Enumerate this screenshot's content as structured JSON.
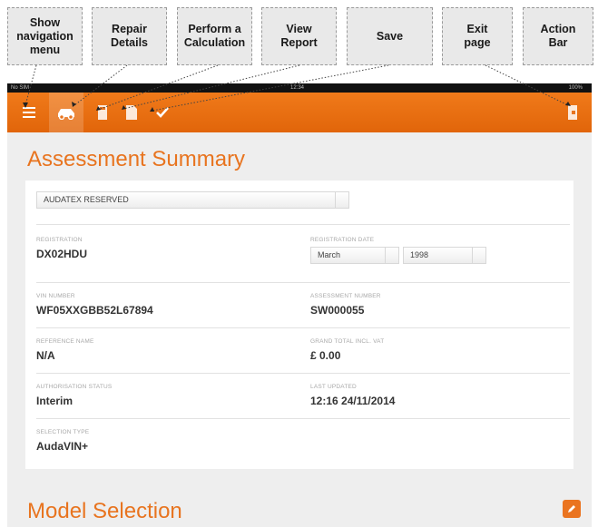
{
  "callouts": {
    "nav_menu": "Show\nnavigation\nmenu",
    "repair_details": "Repair\nDetails",
    "calculation": "Perform a\nCalculation",
    "view_report": "View\nReport",
    "save": "Save",
    "exit_page": "Exit\npage",
    "action_bar": "Action\nBar"
  },
  "status_bar": {
    "carrier": "No SIM",
    "time": "12:34",
    "battery": "100%"
  },
  "toolbar": {
    "icons": [
      "menu-icon",
      "car-icon",
      "calculator-icon",
      "report-icon",
      "checkmark-icon",
      "exit-icon"
    ],
    "color": "#e8741f"
  },
  "summary": {
    "title": "Assessment Summary",
    "dropdown": "AUDATEX RESERVED",
    "fields": {
      "registration_label": "REGISTRATION",
      "registration_value": "DX02HDU",
      "reg_date_label": "REGISTRATION DATE",
      "reg_month": "March",
      "reg_year": "1998",
      "vin_label": "VIN NUMBER",
      "vin_value": "WF05XXGBB52L67894",
      "assessment_label": "ASSESSMENT NUMBER",
      "assessment_value": "SW000055",
      "reference_label": "REFERENCE NAME",
      "reference_value": "N/A",
      "grand_total_label": "GRAND TOTAL INCL. VAT",
      "grand_total_value": "£ 0.00",
      "auth_label": "AUTHORISATION STATUS",
      "auth_value": "Interim",
      "updated_label": "LAST UPDATED",
      "updated_value": "12:16 24/11/2014",
      "selection_label": "SELECTION TYPE",
      "selection_value": "AudaVIN+"
    }
  },
  "model_selection": {
    "title": "Model Selection"
  }
}
